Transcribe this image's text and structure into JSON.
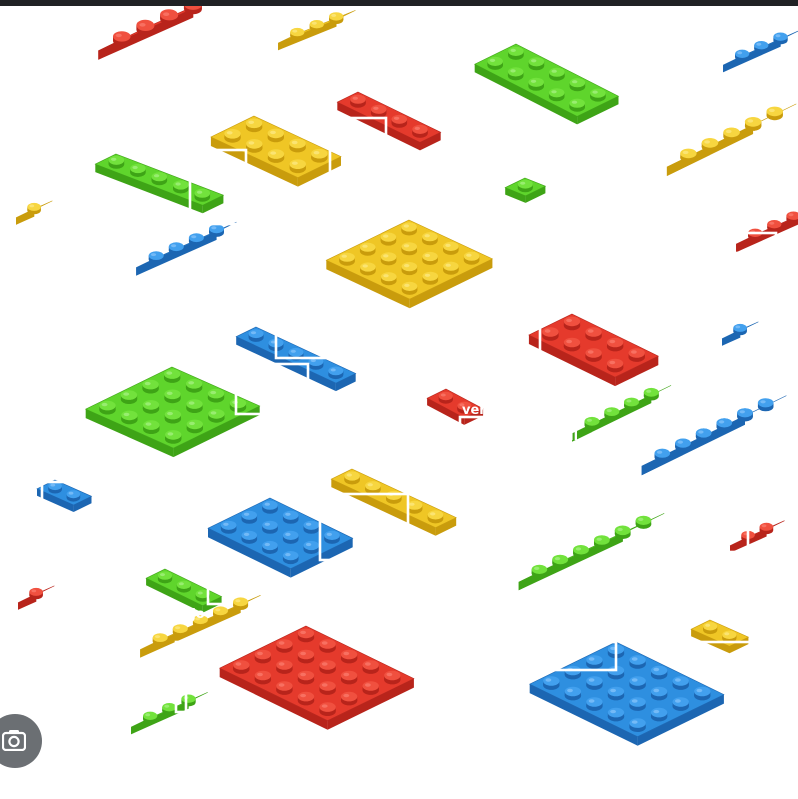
{
  "palette": {
    "rojo": {
      "top": "#e53a2c",
      "side": "#b8241b",
      "stud": "#f0503f",
      "hi": "#ff8a7d"
    },
    "amarillo": {
      "top": "#efc625",
      "side": "#c99c0c",
      "stud": "#f7d640",
      "hi": "#fff09a"
    },
    "verde": {
      "top": "#5fd52c",
      "side": "#3ea416",
      "stud": "#72e23c",
      "hi": "#b8f59a"
    },
    "azul": {
      "top": "#2e8fe0",
      "side": "#1c66b2",
      "stud": "#42a0ee",
      "hi": "#9fd0ff"
    }
  },
  "bricks": [
    {
      "color": "rojo",
      "cols": 4,
      "rows": 2
    },
    {
      "color": "amarillo",
      "cols": 3,
      "rows": 1
    },
    {
      "color": "verde",
      "cols": 5,
      "rows": 2
    },
    {
      "color": "azul",
      "cols": 3,
      "rows": 1
    },
    {
      "color": "rojo",
      "cols": 4,
      "rows": 1
    },
    {
      "color": "amarillo",
      "cols": 4,
      "rows": 2
    },
    {
      "color": "verde",
      "cols": 5,
      "rows": 1
    },
    {
      "color": "verde",
      "cols": 1,
      "rows": 1
    },
    {
      "color": "amarillo",
      "cols": 4,
      "rows": 2
    },
    {
      "color": "amarillo",
      "cols": 1,
      "rows": 1
    },
    {
      "color": "azul",
      "cols": 4,
      "rows": 1
    },
    {
      "color": "amarillo",
      "cols": 4,
      "rows": 4
    },
    {
      "color": "rojo",
      "cols": 5,
      "rows": 1
    },
    {
      "color": "azul",
      "cols": 5,
      "rows": 1
    },
    {
      "color": "rojo",
      "cols": 4,
      "rows": 2
    },
    {
      "color": "azul",
      "cols": 1,
      "rows": 1
    },
    {
      "color": "verde",
      "cols": 4,
      "rows": 4
    },
    {
      "color": "rojo",
      "cols": 2,
      "rows": 1
    },
    {
      "color": "verde",
      "cols": 4,
      "rows": 1
    },
    {
      "color": "azul",
      "cols": 5,
      "rows": 2
    },
    {
      "color": "azul",
      "cols": 2,
      "rows": 1
    },
    {
      "color": "amarillo",
      "cols": 5,
      "rows": 1
    },
    {
      "color": "azul",
      "cols": 4,
      "rows": 3
    },
    {
      "color": "rojo",
      "cols": 2,
      "rows": 1
    },
    {
      "color": "verde",
      "cols": 3,
      "rows": 1
    },
    {
      "color": "rojo",
      "cols": 1,
      "rows": 1
    },
    {
      "color": "verde",
      "cols": 5,
      "rows": 2
    },
    {
      "color": "amarillo",
      "cols": 2,
      "rows": 1
    },
    {
      "color": "amarillo",
      "cols": 5,
      "rows": 1
    },
    {
      "color": "rojo",
      "cols": 5,
      "rows": 4
    },
    {
      "color": "azul",
      "cols": 5,
      "rows": 4
    },
    {
      "color": "verde",
      "cols": 3,
      "rows": 1
    }
  ],
  "labels": [
    "amarillo",
    "amarillo",
    "rojo",
    "rojo",
    "verde",
    "azul",
    "rojo",
    "verde",
    "azul",
    "verde",
    "azul",
    "azul",
    "rojo",
    "amarillo",
    "amarillo",
    "amarillo"
  ],
  "icons": {
    "lens": "camera-lens-icon"
  }
}
